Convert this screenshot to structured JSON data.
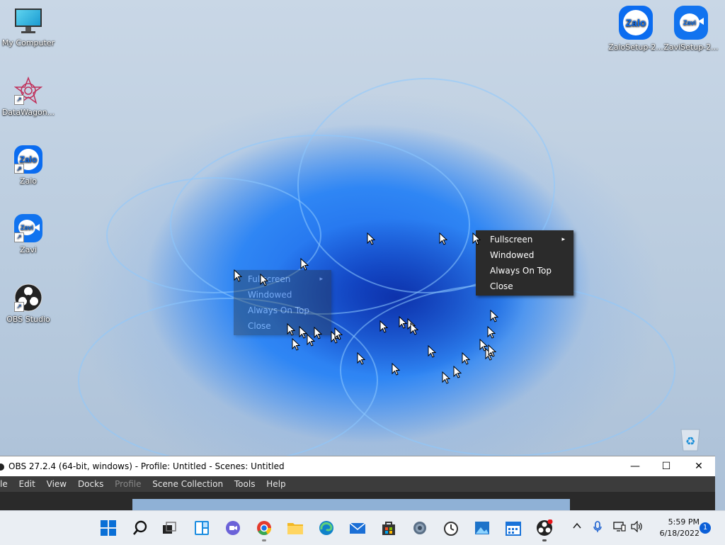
{
  "desktop": {
    "icons": [
      {
        "label": "My Computer",
        "icon": "monitor-icon"
      },
      {
        "label": "DataWagon...",
        "icon": "datawagon-icon"
      },
      {
        "label": "Zalo",
        "icon": "zalo-icon",
        "glyph": "Zalo"
      },
      {
        "label": "Zavi",
        "icon": "zavi-icon",
        "glyph": "Zavi"
      },
      {
        "label": "OBS Studio",
        "icon": "obs-icon"
      },
      {
        "label": "ZaloSetup-2...",
        "icon": "zalo-icon",
        "glyph": "Zalo"
      },
      {
        "label": "ZaviSetup-2...",
        "icon": "zavi-icon",
        "glyph": "Zavi"
      }
    ],
    "recycle_bin_icon": "recycle-bin-icon"
  },
  "context_menu": {
    "items": [
      {
        "label": "Fullscreen",
        "submenu": true
      },
      {
        "label": "Windowed",
        "submenu": false
      },
      {
        "label": "Always On Top",
        "submenu": false
      },
      {
        "label": "Close",
        "submenu": false
      }
    ],
    "submenu_arrow": "▸"
  },
  "ghost_menu": {
    "items": [
      {
        "label": "Fullscreen"
      },
      {
        "label": "Windowed"
      },
      {
        "label": "Always On Top"
      },
      {
        "label": "Close"
      }
    ]
  },
  "obs_window": {
    "title": "OBS 27.2.4 (64-bit, windows) - Profile: Untitled - Scenes: Untitled",
    "menu": [
      "le",
      "Edit",
      "View",
      "Docks",
      "Profile",
      "Scene Collection",
      "Tools",
      "Help"
    ],
    "minimize": "—",
    "maximize": "☐",
    "close": "✕"
  },
  "taskbar": {
    "apps": [
      "start-icon",
      "search-icon",
      "task-view-icon",
      "widgets-icon",
      "teams-chat-icon",
      "chrome-icon",
      "file-explorer-icon",
      "edge-icon",
      "mail-icon",
      "store-icon",
      "settings-icon",
      "clock-app-icon",
      "photos-icon",
      "calendar-icon",
      "obs-icon"
    ],
    "tray": {
      "chevron": "^",
      "mic": "🎙",
      "network": "🖧",
      "volume": "🔊"
    },
    "time": "5:59 PM",
    "date": "6/18/2022",
    "notification_count": "1"
  }
}
